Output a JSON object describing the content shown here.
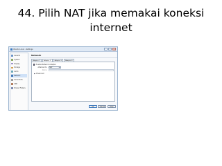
{
  "slide": {
    "title_line1": "44. Pilih NAT jika memakai koneksi",
    "title_line2": "internet"
  },
  "window": {
    "title": "Ubuntu Linux – Settings",
    "controls": [
      "–",
      "□",
      "×"
    ]
  },
  "sidebar": {
    "items": [
      {
        "label": "General",
        "icon": "gear-icon",
        "selected": false
      },
      {
        "label": "System",
        "icon": "chip-icon",
        "selected": false
      },
      {
        "label": "Display",
        "icon": "monitor-icon",
        "selected": false
      },
      {
        "label": "Storage",
        "icon": "disk-icon",
        "selected": false
      },
      {
        "label": "Audio",
        "icon": "speaker-icon",
        "selected": false
      },
      {
        "label": "Network",
        "icon": "network-icon",
        "selected": true
      },
      {
        "label": "Serial Ports",
        "icon": "serial-port-icon",
        "selected": false
      },
      {
        "label": "USB",
        "icon": "usb-icon",
        "selected": false
      },
      {
        "label": "Shared Folders",
        "icon": "folder-icon",
        "selected": false
      }
    ]
  },
  "panel": {
    "title": "Network",
    "tabs": [
      {
        "label": "Adapter 1",
        "active": false
      },
      {
        "label": "Adapter 2",
        "active": true
      },
      {
        "label": "Adapter 3",
        "active": false
      },
      {
        "label": "Adapter 4",
        "active": false
      }
    ],
    "enable_adapter_label": "Enable Network Adapter",
    "enable_adapter_checked": true,
    "attached_to_label": "Attached to:",
    "attached_to_value": "NAT",
    "name_label": "Name:",
    "name_value": "",
    "advanced_label": "Advanced"
  },
  "buttons": {
    "ok": "OK",
    "cancel": "Cancel",
    "help": "Help"
  },
  "colors": {
    "accent": "#3e7bbf",
    "selection": "#cfe1f7"
  }
}
